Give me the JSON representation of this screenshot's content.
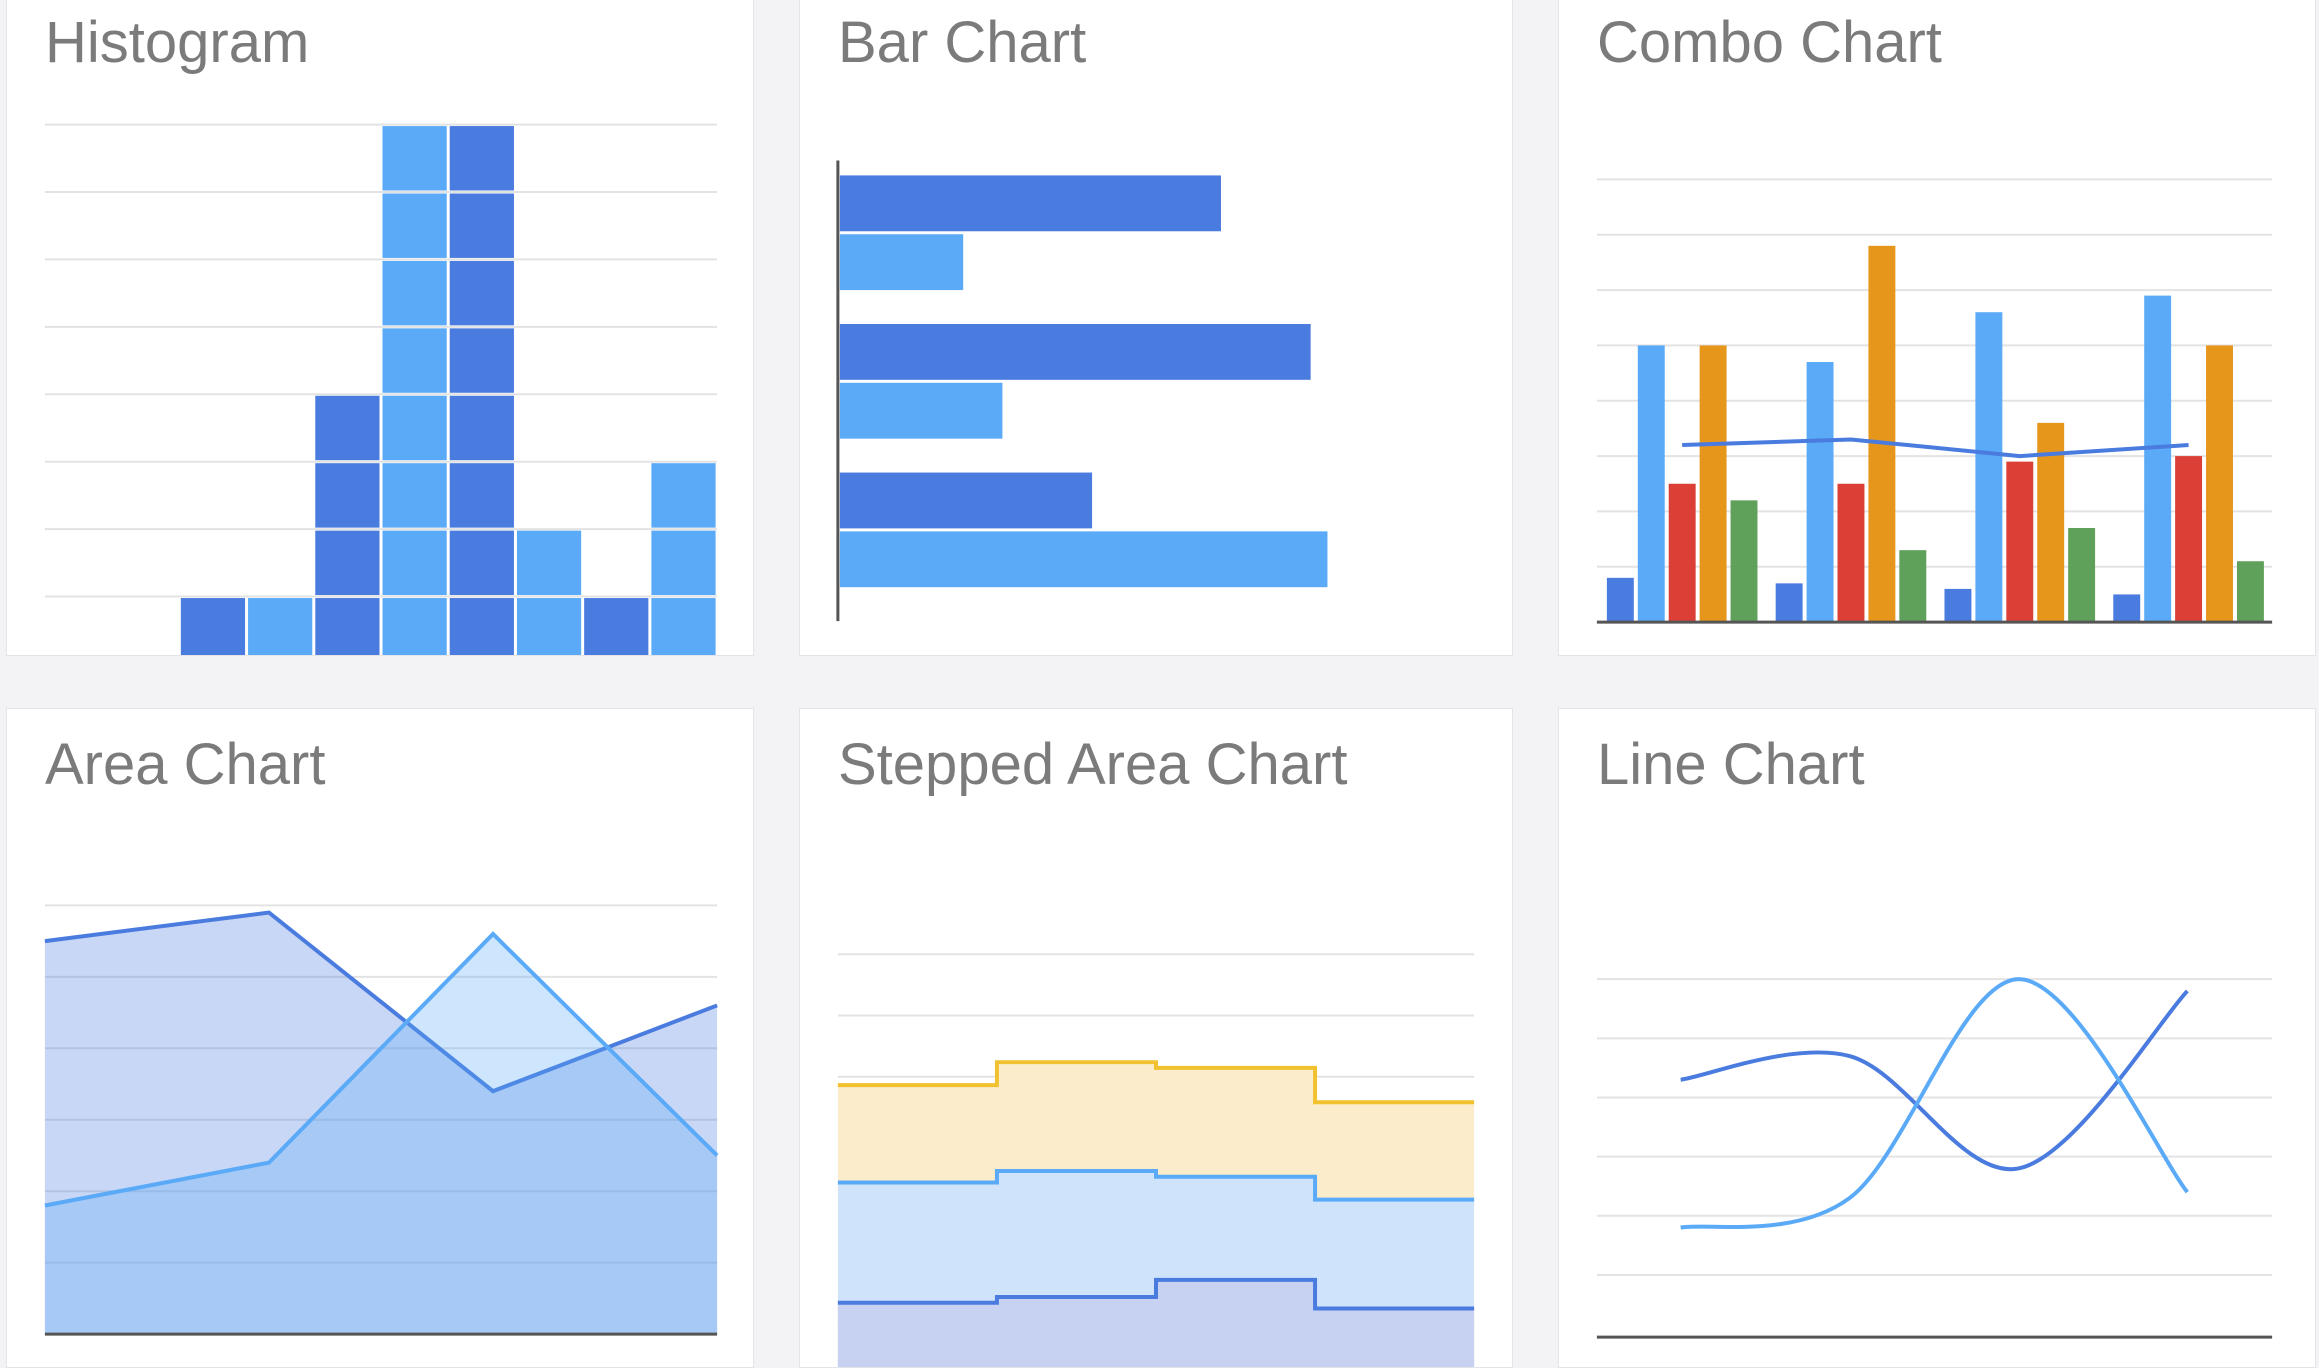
{
  "cards": [
    {
      "title": "Histogram"
    },
    {
      "title": "Bar Chart"
    },
    {
      "title": "Combo Chart"
    },
    {
      "title": "Area Chart"
    },
    {
      "title": "Stepped Area Chart"
    },
    {
      "title": "Line Chart"
    }
  ],
  "colors": {
    "dark_blue": "#4a7bdf",
    "light_blue": "#5aaaf8",
    "red": "#db3f36",
    "orange": "#e5961b",
    "green": "#5fa05a",
    "yellow": "#f2c12f",
    "grid": "#e3e3e3",
    "axis": "#555555"
  },
  "chart_data": [
    {
      "type": "bar",
      "name": "histogram",
      "ylim": [
        0,
        8
      ],
      "bins": [
        {
          "value": 0,
          "color": "dark_blue"
        },
        {
          "value": 0,
          "color": "light_blue"
        },
        {
          "value": 1,
          "color": "dark_blue"
        },
        {
          "value": 1,
          "color": "light_blue"
        },
        {
          "value": 4,
          "color": "dark_blue"
        },
        {
          "value": 8,
          "color": "light_blue"
        },
        {
          "value": 8,
          "color": "dark_blue"
        },
        {
          "value": 2,
          "color": "light_blue"
        },
        {
          "value": 1,
          "color": "dark_blue"
        },
        {
          "value": 3,
          "color": "light_blue"
        }
      ],
      "grid": true
    },
    {
      "type": "bar",
      "name": "horizontal-bar",
      "orientation": "horizontal",
      "xlim": [
        0,
        100
      ],
      "groups": [
        {
          "series1": 68,
          "series2": 22
        },
        {
          "series1": 84,
          "series2": 29
        },
        {
          "series1": 45,
          "series2": 87
        }
      ],
      "grid": false
    },
    {
      "type": "bar",
      "name": "combo",
      "ylim": [
        0,
        8
      ],
      "groups": [
        {
          "values": [
            0.8,
            5.0,
            2.5,
            5.0,
            2.2
          ],
          "line": 3.2
        },
        {
          "values": [
            0.7,
            4.7,
            2.5,
            6.8,
            1.3
          ],
          "line": 3.3
        },
        {
          "values": [
            0.6,
            5.6,
            2.9,
            3.6,
            1.7
          ],
          "line": 3.0
        },
        {
          "values": [
            0.5,
            5.9,
            3.0,
            5.0,
            1.1
          ],
          "line": 3.2
        }
      ],
      "series_colors": [
        "dark_blue",
        "light_blue",
        "red",
        "orange",
        "green"
      ],
      "line_color": "dark_blue",
      "grid": true
    },
    {
      "type": "area",
      "name": "area",
      "ylim": [
        0,
        6
      ],
      "series": [
        {
          "values": [
            5.5,
            5.9,
            3.4,
            4.6
          ],
          "color": "dark_blue"
        },
        {
          "values": [
            1.8,
            2.4,
            5.6,
            2.5
          ],
          "color": "light_blue"
        }
      ],
      "grid": true
    },
    {
      "type": "area",
      "name": "stepped-area",
      "stepped": true,
      "ylim": [
        0,
        6
      ],
      "series": [
        {
          "values": [
            1.4,
            1.5,
            1.8,
            1.3
          ],
          "color": "dark_blue"
        },
        {
          "values": [
            3.5,
            3.7,
            3.6,
            3.2
          ],
          "color": "light_blue"
        },
        {
          "values": [
            5.2,
            5.6,
            5.5,
            4.9
          ],
          "color": "yellow"
        }
      ],
      "grid": true
    },
    {
      "type": "line",
      "name": "line",
      "ylim": [
        0,
        6
      ],
      "series": [
        {
          "values": [
            4.3,
            4.7,
            2.8,
            5.8
          ],
          "color": "dark_blue"
        },
        {
          "values": [
            1.8,
            2.3,
            6.0,
            2.4
          ],
          "color": "light_blue"
        }
      ],
      "grid": true
    }
  ]
}
